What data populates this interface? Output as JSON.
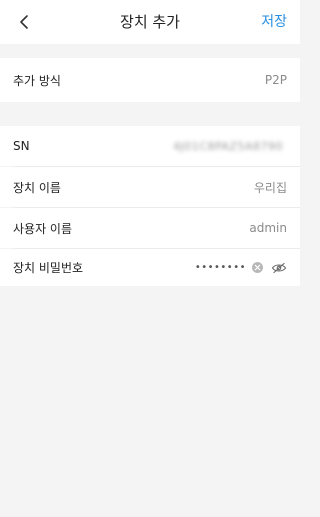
{
  "header": {
    "title": "장치 추가",
    "save_label": "저장"
  },
  "method": {
    "label": "추가 방식",
    "value": "P2P"
  },
  "fields": {
    "sn": {
      "label": "SN",
      "value": "4J01C8PAZ5A8790"
    },
    "device_name": {
      "label": "장치 이름",
      "value": "우리집"
    },
    "username": {
      "label": "사용자 이름",
      "value": "admin"
    },
    "password": {
      "label": "장치 비밀번호",
      "masked": "••••••••"
    }
  },
  "icons": {
    "back": "chevron-left-icon",
    "clear": "clear-icon",
    "visibility": "eye-slash-icon"
  },
  "colors": {
    "accent": "#2a8fe0",
    "background": "#f4f4f5"
  }
}
